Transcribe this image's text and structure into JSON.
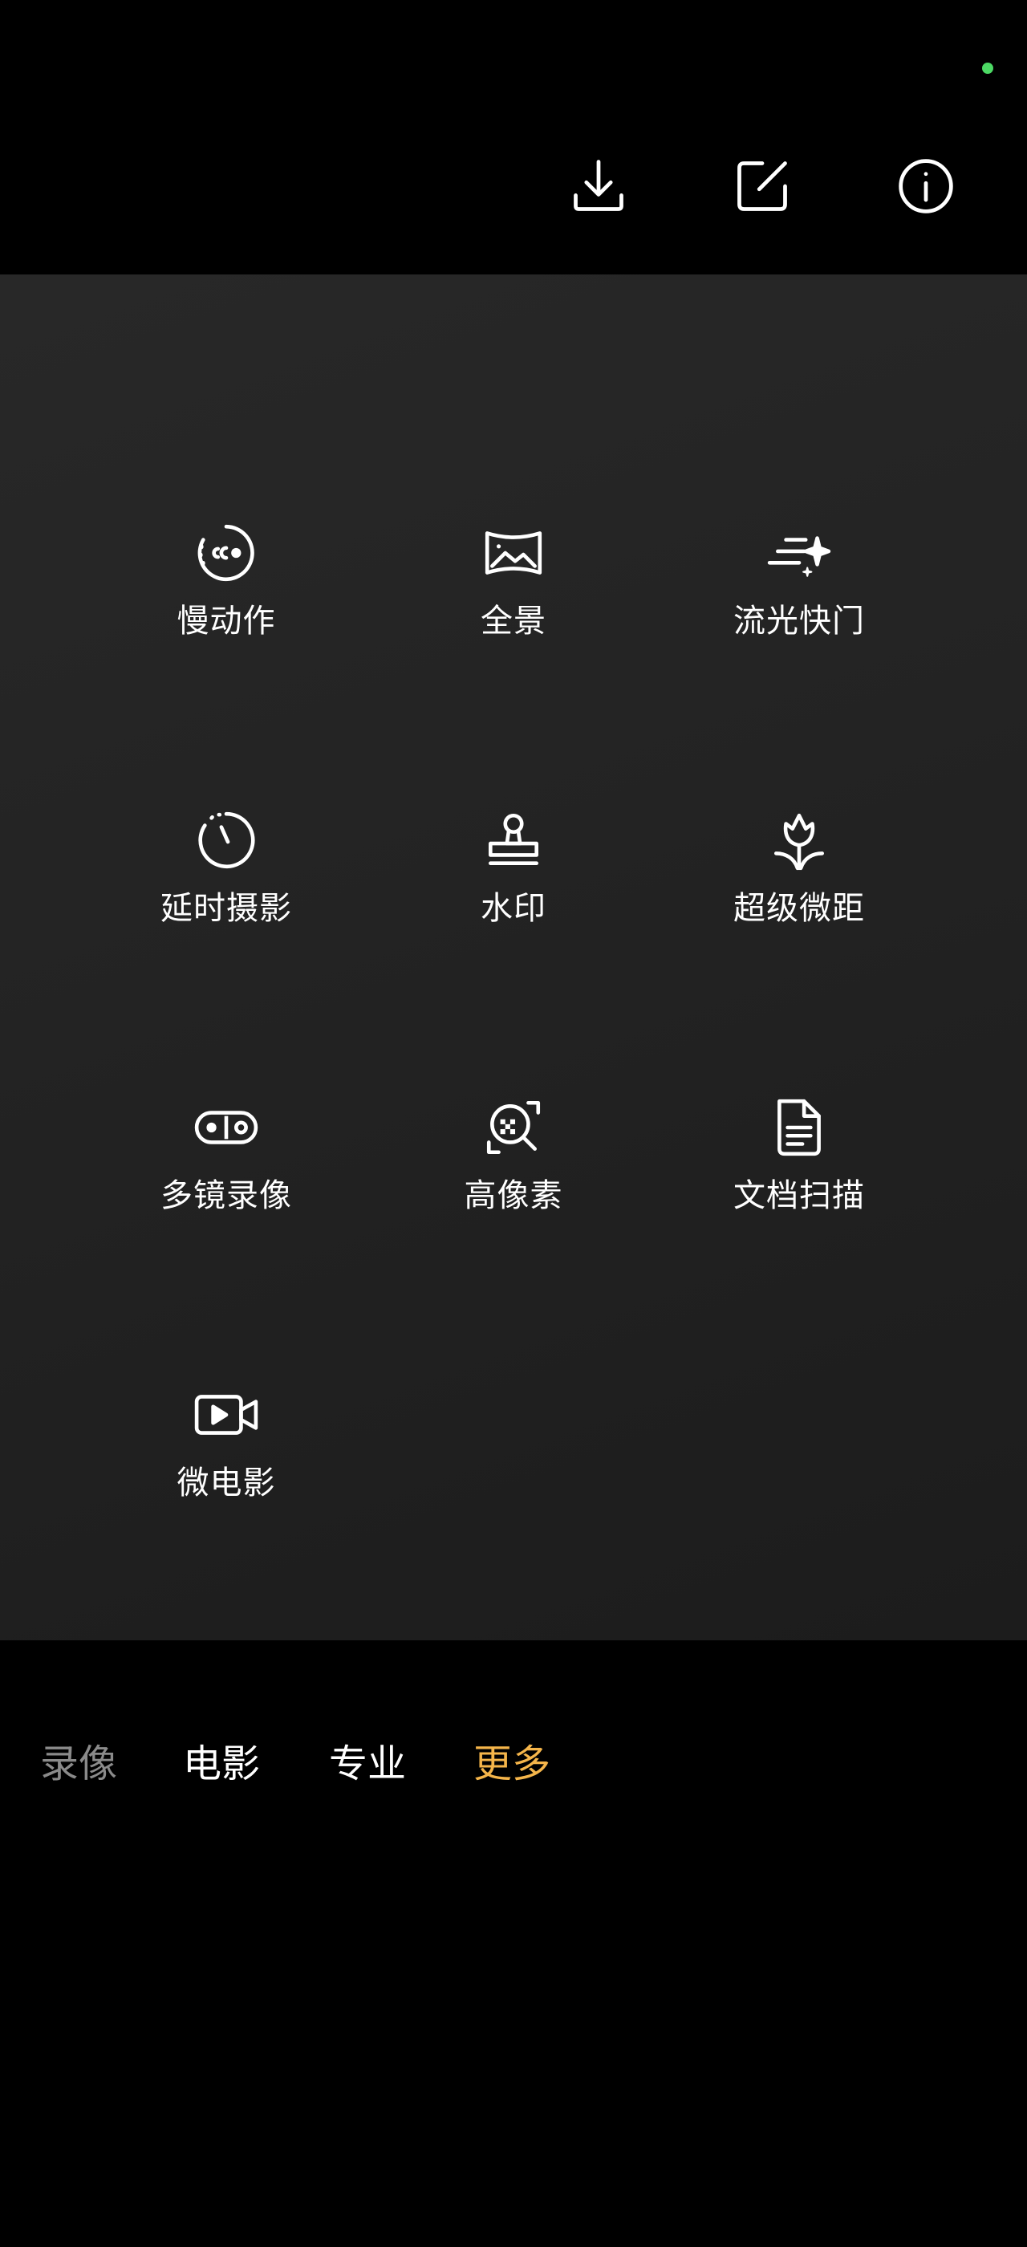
{
  "top_bar": {
    "icons": [
      "download-icon",
      "edit-icon",
      "info-icon"
    ]
  },
  "modes": [
    {
      "label": "慢动作",
      "icon": "slow-motion-icon"
    },
    {
      "label": "全景",
      "icon": "panorama-icon"
    },
    {
      "label": "流光快门",
      "icon": "light-trail-shutter-icon"
    },
    {
      "label": "延时摄影",
      "icon": "timelapse-icon"
    },
    {
      "label": "水印",
      "icon": "stamp-icon"
    },
    {
      "label": "超级微距",
      "icon": "macro-flower-icon"
    },
    {
      "label": "多镜录像",
      "icon": "multi-camera-icon"
    },
    {
      "label": "高像素",
      "icon": "high-pixel-icon"
    },
    {
      "label": "文档扫描",
      "icon": "document-scan-icon"
    },
    {
      "label": "微电影",
      "icon": "movie-camera-icon"
    }
  ],
  "mode_tabs": [
    {
      "label": "录像",
      "state": "faded"
    },
    {
      "label": "电影",
      "state": "normal"
    },
    {
      "label": "专业",
      "state": "normal"
    },
    {
      "label": "更多",
      "state": "active"
    }
  ],
  "colors": {
    "accent": "#f5b54a",
    "status_dot": "#4cd964",
    "panel": "#232323",
    "background": "#000000"
  }
}
